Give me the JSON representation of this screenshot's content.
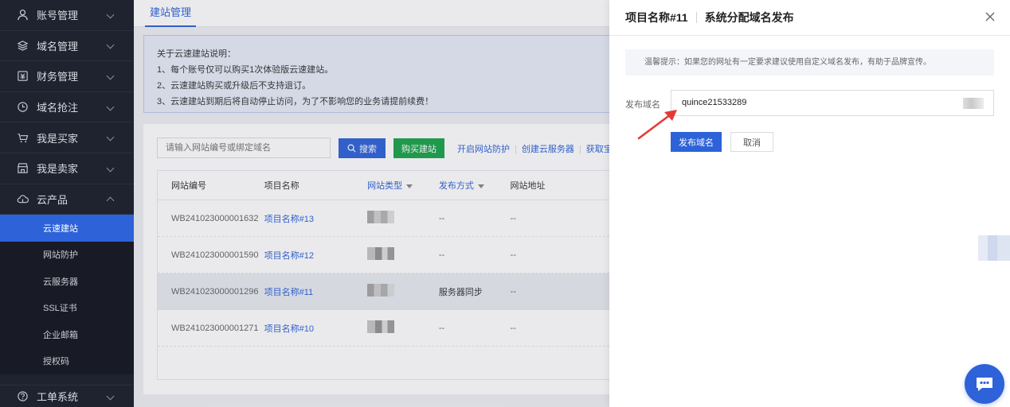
{
  "sidebar": {
    "items": [
      {
        "label": "账号管理",
        "icon": "user-icon"
      },
      {
        "label": "域名管理",
        "icon": "layers-icon"
      },
      {
        "label": "财务管理",
        "icon": "finance-icon"
      },
      {
        "label": "域名抢注",
        "icon": "clock-icon"
      },
      {
        "label": "我是买家",
        "icon": "cart-icon"
      },
      {
        "label": "我是卖家",
        "icon": "store-icon"
      },
      {
        "label": "云产品",
        "icon": "cloud-icon"
      }
    ],
    "sub_items": [
      "云速建站",
      "网站防护",
      "云服务器",
      "SSL证书",
      "企业邮箱",
      "授权码"
    ],
    "bottom_item": {
      "label": "工单系统",
      "icon": "help-icon"
    }
  },
  "main": {
    "tab": "建站管理",
    "notice": {
      "title": "关于云速建站说明：",
      "lines": [
        "1、每个账号仅可以购买1次体验版云速建站。",
        "2、云速建站购买或升级后不支持退订。",
        "3、云速建站到期后将自动停止访问，为了不影响您的业务请提前续费！"
      ]
    },
    "search": {
      "placeholder": "请输入网站编号或绑定域名",
      "button": "搜索"
    },
    "buy_button": "购买建站",
    "links": [
      "开启网站防护",
      "创建云服务器",
      "获取宝"
    ],
    "table": {
      "headers": [
        "网站编号",
        "项目名称",
        "网站类型",
        "发布方式",
        "网站地址"
      ],
      "rows": [
        {
          "id": "WB241023000001632",
          "name": "项目名称#13",
          "publish": "--",
          "url": "--"
        },
        {
          "id": "WB241023000001590",
          "name": "项目名称#12",
          "publish": "--",
          "url": "--"
        },
        {
          "id": "WB241023000001296",
          "name": "项目名称#11",
          "publish": "服务器同步",
          "url": "--"
        },
        {
          "id": "WB241023000001271",
          "name": "项目名称#10",
          "publish": "--",
          "url": "--"
        }
      ]
    }
  },
  "drawer": {
    "project": "项目名称#11",
    "title": "系统分配域名发布",
    "tip": "温馨提示：如果您的网址有一定要求建议使用自定义域名发布，有助于品牌宣传。",
    "field_label": "发布域名",
    "domain_value": "quince21533289",
    "publish_button": "发布域名",
    "cancel_button": "取消"
  },
  "colors": {
    "primary": "#2d62d9",
    "success": "#1aa34a",
    "sidebar": "#1f2330",
    "arrow": "#e53935"
  }
}
